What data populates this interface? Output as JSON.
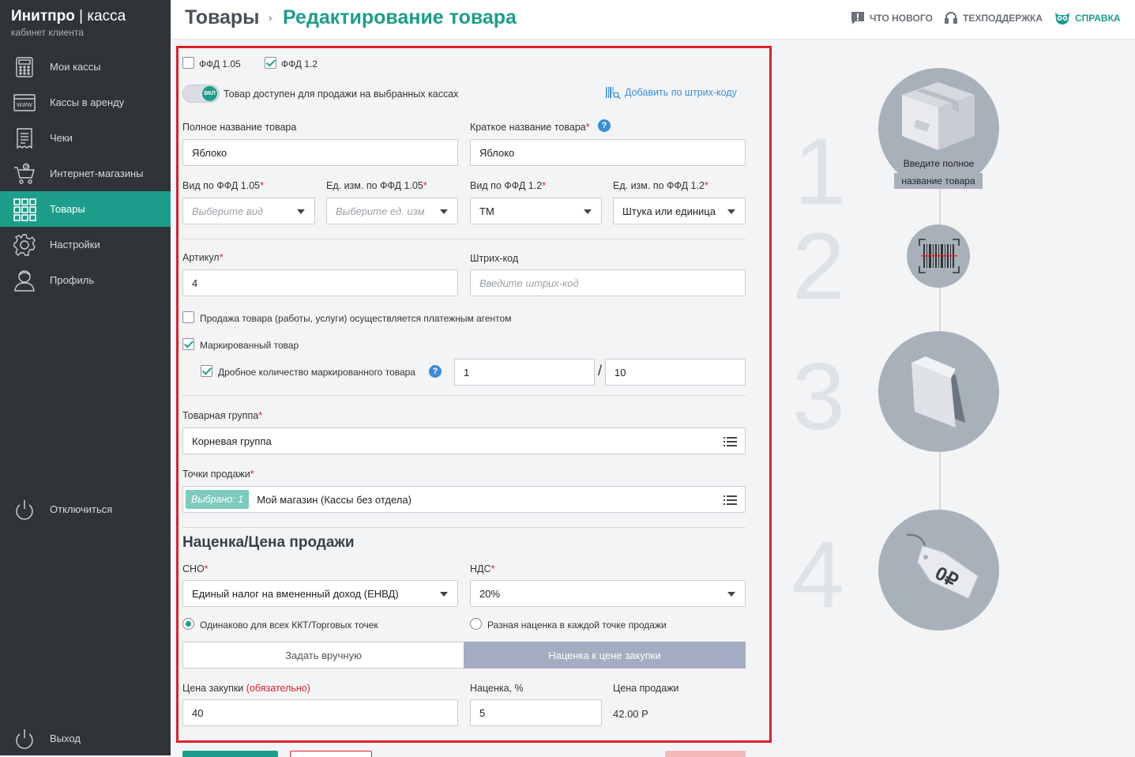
{
  "sidebar": {
    "logo_bold": "Инитпро",
    "logo_sep": " | ",
    "logo_light": "касса",
    "logo_sub": "кабинет клиента",
    "items": [
      {
        "label": "Мои кассы",
        "icon": "cash-register-icon"
      },
      {
        "label": "Кассы в аренду",
        "icon": "web-window-icon"
      },
      {
        "label": "Чеки",
        "icon": "receipt-icon"
      },
      {
        "label": "Интернет-магазины",
        "icon": "shopping-cart-icon"
      },
      {
        "label": "Товары",
        "icon": "grid-icon",
        "active": true
      },
      {
        "label": "Настройки",
        "icon": "gear-icon"
      },
      {
        "label": "Профиль",
        "icon": "user-icon"
      }
    ],
    "disconnect": "Отключиться",
    "logout": "Выход"
  },
  "header": {
    "crumb1": "Товары",
    "crumb_sep": "›",
    "crumb2": "Редактирование товара",
    "links": [
      {
        "label": "ЧТО НОВОГО",
        "icon": "chat-alert-icon"
      },
      {
        "label": "ТЕХПОДДЕРЖКА",
        "icon": "headset-icon"
      },
      {
        "label": "СПРАВКА",
        "icon": "owl-icon"
      }
    ]
  },
  "form": {
    "ffd105": {
      "label": "ФФД 1.05",
      "checked": false
    },
    "ffd12": {
      "label": "ФФД 1.2",
      "checked": true
    },
    "toggle_text": "ВКЛ",
    "toggle_label": "Товар доступен для продажи на выбранных кассах",
    "barcode_link": "Добавить по штрих-коду",
    "full_name_label": "Полное название товара",
    "full_name_value": "Яблоко",
    "short_name_label": "Краткое название товара",
    "short_name_value": "Яблоко",
    "req_mark": "*",
    "help_mark": "?",
    "kind105_label": "Вид по ФФД 1.05",
    "kind105_placeholder": "Выберите вид",
    "unit105_label": "Ед. изм. по ФФД 1.05",
    "unit105_placeholder": "Выберите ед. изм",
    "kind12_label": "Вид по ФФД 1.2",
    "kind12_value": "ТМ",
    "unit12_label": "Ед. изм. по ФФД 1.2",
    "unit12_value": "Штука или единица",
    "article_label": "Артикул",
    "article_value": "4",
    "barcode_label": "Штрих-код",
    "barcode_placeholder": "Введите штрих-код",
    "agent_label": "Продажа товара (работы, услуги) осуществляется платежным агентом",
    "agent_checked": false,
    "marked_label": "Маркированный товар",
    "marked_checked": true,
    "fraction_label": "Дробное количество маркированного товара",
    "fraction_checked": true,
    "fraction_num": "1",
    "fraction_slash": "/",
    "fraction_den": "10",
    "group_label": "Товарная группа",
    "group_value": "Корневая группа",
    "points_label": "Точки продажи",
    "points_badge": "Выбрано: 1",
    "points_value": "Мой магазин (Кассы без отдела)",
    "section_title": "Наценка/Цена продажи",
    "sno_label": "СНО",
    "sno_value": "Единый налог на вмененный доход (ЕНВД)",
    "nds_label": "НДС",
    "nds_value": "20%",
    "radio_same": "Одинаково для всех ККТ/Торговых точек",
    "radio_diff": "Разная наценка в каждой точке продажи",
    "tab_manual": "Задать вручную",
    "tab_markup": "Наценка к цене закупки",
    "purchase_label": "Цена закупки",
    "purchase_required": "(обязательно)",
    "purchase_value": "40",
    "markup_label": "Наценка, %",
    "markup_value": "5",
    "sale_label": "Цена продажи",
    "sale_value": "42.00 Р"
  },
  "steps": {
    "numbers": [
      "1",
      "2",
      "3",
      "4"
    ],
    "step1_caption_line1": "Введите полное",
    "step1_caption_line2": "название товара",
    "price_tag_text": "0₽"
  },
  "colors": {
    "accent": "#1c9e8a",
    "sidebar": "#2f3439",
    "highlight_border": "#e0202a",
    "link": "#3a8ed8"
  }
}
